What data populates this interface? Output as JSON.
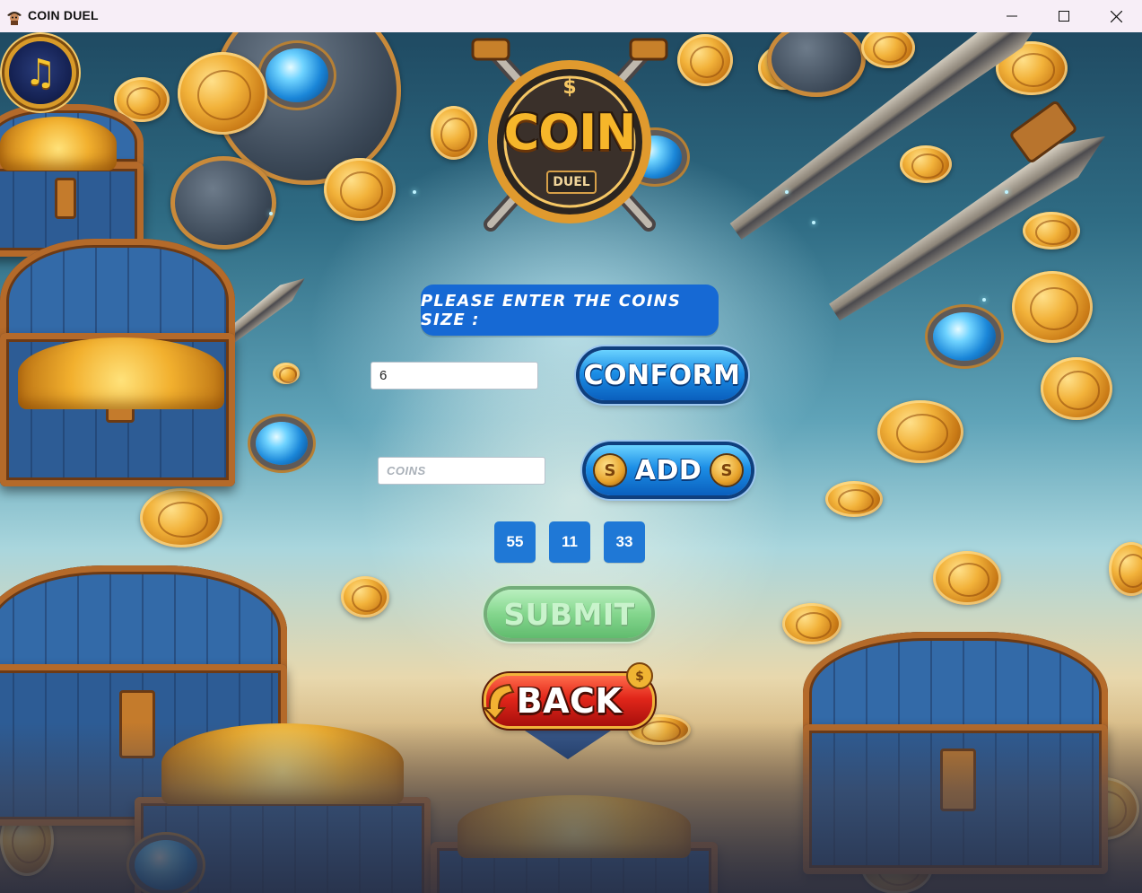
{
  "window": {
    "title": "COIN DUEL",
    "icon": "pirate-icon",
    "controls": {
      "minimize": "minimize-icon",
      "maximize": "maximize-icon",
      "close": "close-icon"
    }
  },
  "logo": {
    "title": "COIN",
    "subtitle": "DUEL"
  },
  "music": {
    "icon": "music-note-icon",
    "glyph": "♫"
  },
  "prompt": {
    "text": "PLEASE ENTER THE COINS SIZE :"
  },
  "size_input": {
    "value": "6",
    "placeholder": ""
  },
  "conform_button": {
    "label": "CONFORM"
  },
  "coins_input": {
    "value": "",
    "placeholder": "COINS"
  },
  "add_button": {
    "label": "ADD",
    "coin_glyph": "S"
  },
  "coins": [
    "55",
    "11",
    "33"
  ],
  "submit_button": {
    "label": "SUBMIT",
    "state": "disabled"
  },
  "back_button": {
    "label": "BACK"
  },
  "colors": {
    "prompt_bg": "#1669d4",
    "chip_bg": "#1f78d6",
    "conform_bg": "#1c8ee6",
    "submit_bg": "#7cd687",
    "back_bg": "#e1261a"
  }
}
